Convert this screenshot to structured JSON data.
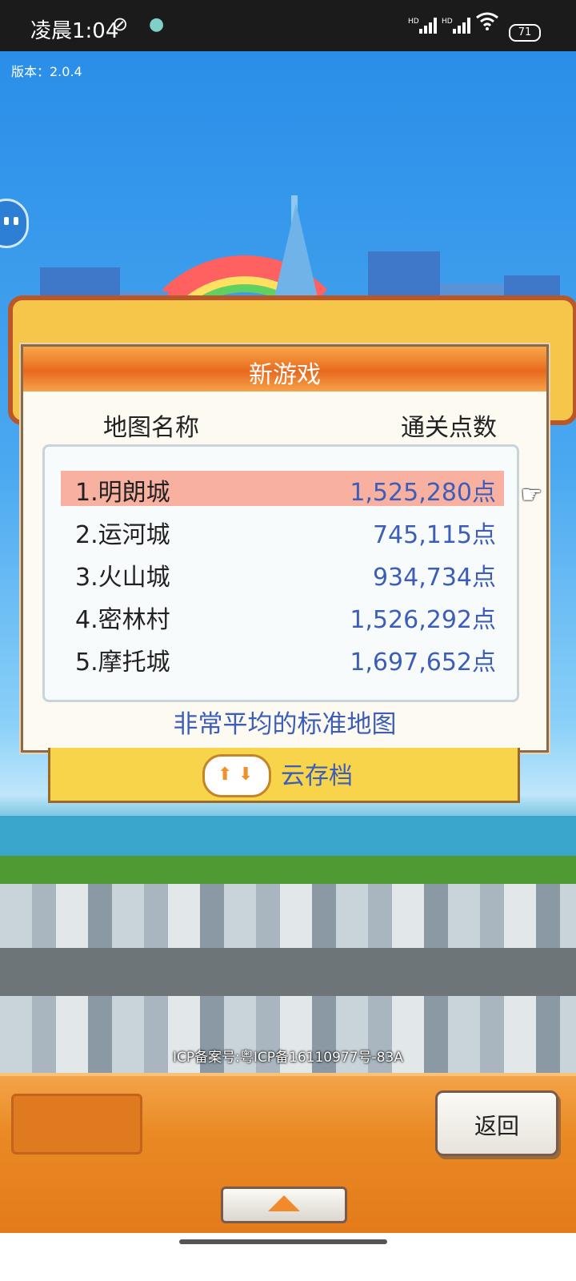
{
  "status_bar": {
    "time": "凌晨1:04",
    "signal1": "HD",
    "signal2": "HD",
    "battery": "71"
  },
  "game": {
    "version": "版本：2.0.4",
    "icp": "ICP备案号:粤ICP备16110977号-83A"
  },
  "dialog": {
    "title": "新游戏",
    "col_name": "地图名称",
    "col_score": "通关点数",
    "maps": [
      {
        "name": "1.明朗城",
        "score": "1,525,280点",
        "selected": true
      },
      {
        "name": "2.运河城",
        "score": "745,115点",
        "selected": false
      },
      {
        "name": "3.火山城",
        "score": "934,734点",
        "selected": false
      },
      {
        "name": "4.密林村",
        "score": "1,526,292点",
        "selected": false
      },
      {
        "name": "5.摩托城",
        "score": "1,697,652点",
        "selected": false
      }
    ],
    "description": "非常平均的标准地图"
  },
  "cloud_save": {
    "label": "云存档"
  },
  "bottom": {
    "back_label": "返回"
  },
  "colors": {
    "accent_orange": "#e86a1e",
    "score_blue": "#3d5eb8",
    "selected_row": "#f8b0a0"
  }
}
